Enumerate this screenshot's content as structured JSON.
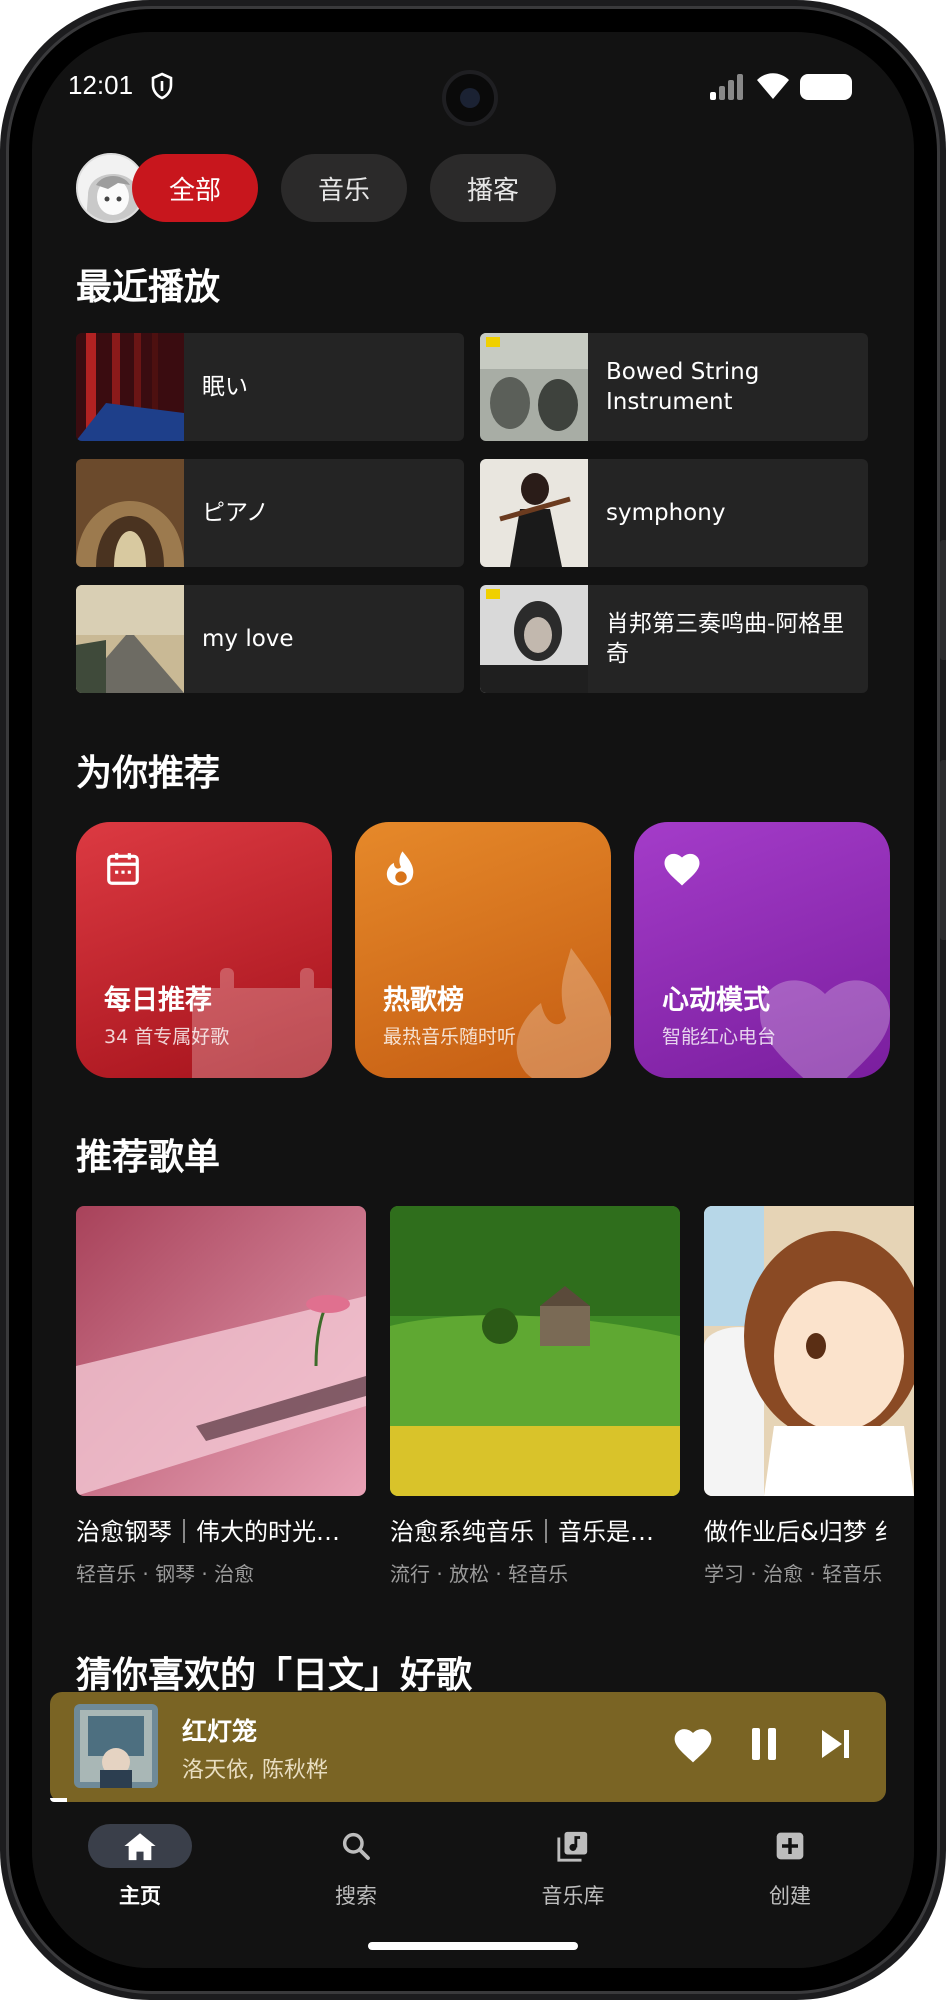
{
  "status_bar": {
    "time": "12:01"
  },
  "filter_chips": [
    {
      "label": "全部",
      "active": true
    },
    {
      "label": "音乐",
      "active": false
    },
    {
      "label": "播客",
      "active": false
    }
  ],
  "recent": {
    "title": "最近播放",
    "items": [
      {
        "label": "眠い"
      },
      {
        "label": "Bowed String Instrument"
      },
      {
        "label": "ピアノ"
      },
      {
        "label": "symphony"
      },
      {
        "label": "my love"
      },
      {
        "label": "肖邦第三奏鸣曲-阿格里奇"
      }
    ]
  },
  "for_you": {
    "title": "为你推荐",
    "cards": [
      {
        "title": "每日推荐",
        "subtitle": "34 首专属好歌",
        "icon": "calendar-icon",
        "color": "#c4222b"
      },
      {
        "title": "热歌榜",
        "subtitle": "最热音乐随时听",
        "icon": "flame-icon",
        "color": "#d8741a"
      },
      {
        "title": "心动模式",
        "subtitle": "智能红心电台",
        "icon": "heart-icon",
        "color": "#8e2fb8"
      }
    ]
  },
  "playlists": {
    "title": "推荐歌单",
    "items": [
      {
        "title": "治愈钢琴｜伟大的时光…",
        "tags": "轻音乐 · 钢琴 · 治愈"
      },
      {
        "title": "治愈系纯音乐｜音乐是…",
        "tags": "流行 · 放松 · 轻音乐"
      },
      {
        "title": "做作业后&归梦 纟",
        "tags": "学习 · 治愈 · 轻音乐"
      }
    ]
  },
  "next_section": {
    "title": "猜你喜欢的「日文」好歌"
  },
  "mini_player": {
    "song": "红灯笼",
    "artist": "洛天依, 陈秋桦",
    "background": "#7a6424",
    "progress": 0.02
  },
  "bottom_nav": [
    {
      "label": "主页",
      "icon": "home-icon",
      "active": true
    },
    {
      "label": "搜索",
      "icon": "search-icon",
      "active": false
    },
    {
      "label": "音乐库",
      "icon": "library-icon",
      "active": false
    },
    {
      "label": "创建",
      "icon": "add-box-icon",
      "active": false
    }
  ]
}
